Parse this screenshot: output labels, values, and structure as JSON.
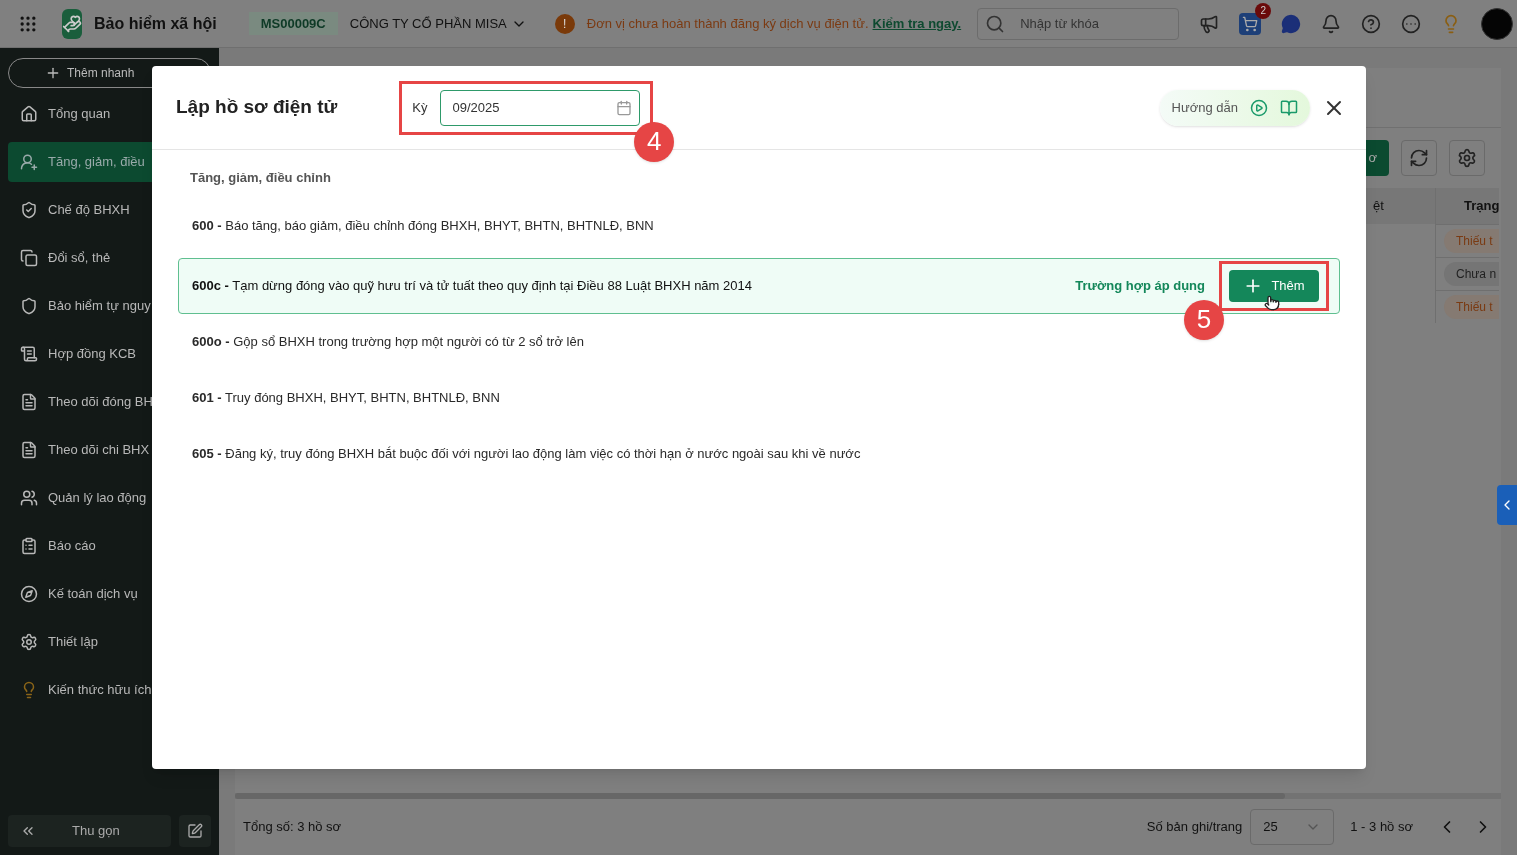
{
  "header": {
    "app_name": "Bảo hiểm xã hội",
    "company_code": "MS00009C",
    "company_name": "CÔNG TY CỔ PHẦN MISA",
    "warning_icon": "!",
    "warning": "Đơn vị chưa hoàn thành đăng ký dịch vụ điện tử.",
    "warning_link": "Kiểm tra ngay.",
    "search": {
      "placeholder": "Nhập từ khóa"
    },
    "cart_badge": "2"
  },
  "sidebar": {
    "quick_add": "Thêm nhanh",
    "items": [
      {
        "label": "Tổng quan",
        "selected": false
      },
      {
        "label": "Tăng, giảm, điều",
        "selected": true
      },
      {
        "label": "Chế độ BHXH",
        "selected": false
      },
      {
        "label": "Đổi sổ, thẻ",
        "selected": false
      },
      {
        "label": "Bảo hiểm tự nguy",
        "selected": false
      },
      {
        "label": "Hợp đồng KCB",
        "selected": false
      },
      {
        "label": "Theo dõi đóng BH",
        "selected": false
      },
      {
        "label": "Theo dõi chi BHX",
        "selected": false
      },
      {
        "label": "Quản lý lao động",
        "selected": false
      },
      {
        "label": "Báo cáo",
        "selected": false
      },
      {
        "label": "Kế toán dịch vụ",
        "selected": false
      },
      {
        "label": "Thiết lập",
        "selected": false
      },
      {
        "label": "Kiến thức hữu ích",
        "selected": false
      }
    ],
    "collapse": "Thu gọn"
  },
  "background": {
    "toolbar_button": "ơ",
    "table": {
      "columns": [
        "ệt",
        "Trạng"
      ],
      "status_cells": [
        {
          "text": "Thiếu t",
          "kind": "warning"
        },
        {
          "text": "Chưa n",
          "kind": "neutral"
        },
        {
          "text": "Thiếu t",
          "kind": "warning"
        }
      ]
    },
    "footer": {
      "total": "Tổng số: 3 hồ sơ",
      "page_size_label": "Số bản ghi/trang",
      "page_size": "25",
      "range": "1 - 3 hồ sơ"
    }
  },
  "modal": {
    "title": "Lập hồ sơ điện tử",
    "period_label": "Kỳ",
    "period_value": "09/2025",
    "guide": "Hướng dẫn",
    "section": "Tăng, giảm, điều chỉnh",
    "rows": [
      {
        "code": "600 -",
        "text": "Báo tăng, báo giảm, điều chỉnh đóng BHXH, BHYT, BHTN, BHTNLĐ, BNN",
        "selected": false
      },
      {
        "code": "600c -",
        "text": "Tạm dừng đóng vào quỹ hưu trí và tử tuất theo quy định tại Điều 88 Luật BHXH năm 2014",
        "selected": true
      },
      {
        "code": "600o -",
        "text": "Gộp sổ BHXH trong trường hợp một người có từ 2 sổ trở lên",
        "selected": false
      },
      {
        "code": "601 -",
        "text": "Truy đóng BHXH, BHYT, BHTN, BHTNLĐ, BNN",
        "selected": false
      },
      {
        "code": "605 -",
        "text": "Đăng ký, truy đóng BHXH bắt buộc đối với người lao động làm việc có thời hạn ở nước ngoài sau khi về nước",
        "selected": false
      }
    ],
    "row_link": "Trường hợp áp dụng",
    "add_button": "Thêm"
  },
  "annotations": [
    {
      "label": "4"
    },
    {
      "label": "5"
    }
  ]
}
